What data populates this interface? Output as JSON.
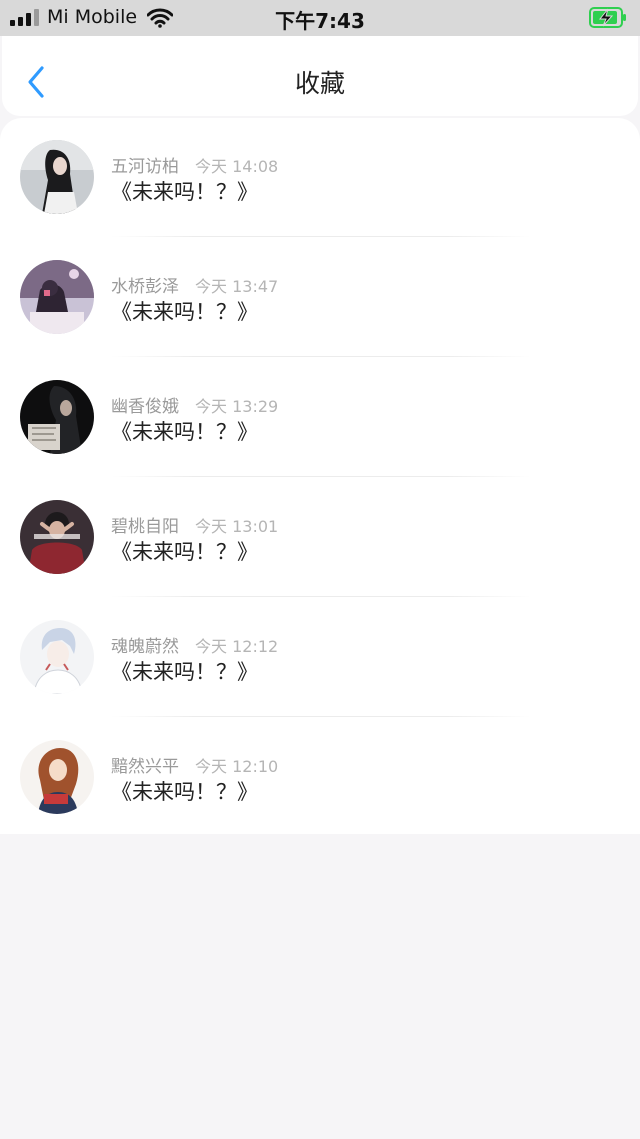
{
  "status_bar": {
    "carrier": "Mi Mobile",
    "time": "下午7:43"
  },
  "header": {
    "title": "收藏"
  },
  "favorites": [
    {
      "name": "五河访柏",
      "time": "今天 14:08",
      "title": "《未来吗！？》"
    },
    {
      "name": "水桥彭泽",
      "time": "今天 13:47",
      "title": "《未来吗！？》"
    },
    {
      "name": "幽香俊娥",
      "time": "今天 13:29",
      "title": "《未来吗！？》"
    },
    {
      "name": "碧桃自阳",
      "time": "今天 13:01",
      "title": "《未来吗！？》"
    },
    {
      "name": "魂魄蔚然",
      "time": "今天 12:12",
      "title": "《未来吗！？》"
    },
    {
      "name": "黯然兴平",
      "time": "今天 12:10",
      "title": "《未来吗！？》"
    }
  ],
  "colors": {
    "accent": "#2f9bff",
    "battery": "#2fcf4f"
  }
}
